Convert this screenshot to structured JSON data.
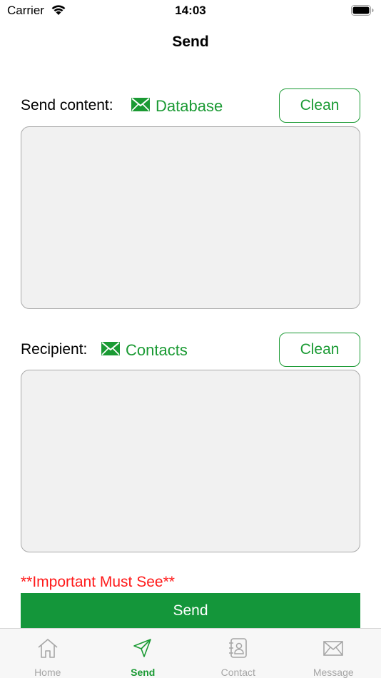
{
  "status_bar": {
    "carrier": "Carrier",
    "time": "14:03"
  },
  "nav": {
    "title": "Send"
  },
  "content_section": {
    "label": "Send content:",
    "link_label": "Database",
    "clean_label": "Clean",
    "value": ""
  },
  "recipient_section": {
    "label": "Recipient:",
    "link_label": "Contacts",
    "clean_label": "Clean",
    "value": ""
  },
  "notice": "**Important Must See**",
  "send_button_label": "Send",
  "tabs": [
    {
      "label": "Home",
      "icon": "home-icon",
      "active": false
    },
    {
      "label": "Send",
      "icon": "send-icon",
      "active": true
    },
    {
      "label": "Contact",
      "icon": "contact-book-icon",
      "active": false
    },
    {
      "label": "Message",
      "icon": "envelope-icon",
      "active": false
    }
  ],
  "colors": {
    "accent": "#1a9a33",
    "send_button": "#14963a",
    "warning": "#ff1a1a",
    "tab_inactive": "#a6a6a6"
  }
}
